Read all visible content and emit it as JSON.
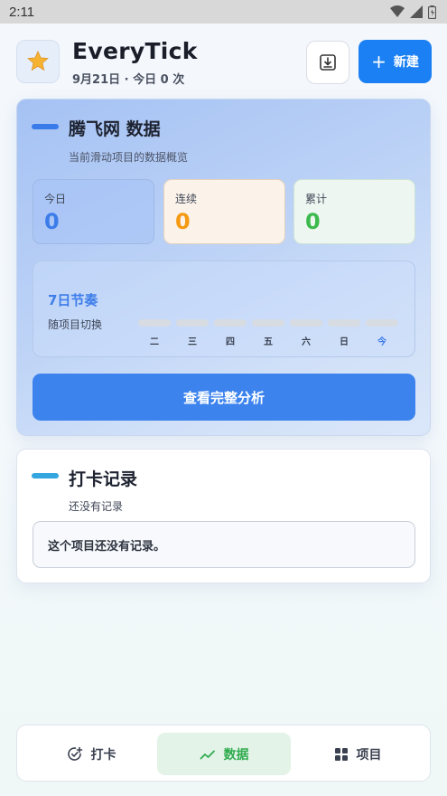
{
  "status_bar": {
    "time": "2:11"
  },
  "header": {
    "app_title": "EveryTick",
    "subtitle": "9月21日 · 今日 0 次",
    "app_icon": "star-icon",
    "import_icon": "download-tray-icon",
    "new_label": "新建"
  },
  "data_card": {
    "title": "腾飞网 数据",
    "subtitle": "当前滑动项目的数据概览",
    "stats": [
      {
        "label": "今日",
        "value": "0",
        "color": "#3d7de9"
      },
      {
        "label": "连续",
        "value": "0",
        "color": "#f59a12"
      },
      {
        "label": "累计",
        "value": "0",
        "color": "#3dba4e"
      }
    ],
    "rhythm": {
      "title": "7日节奏",
      "subtitle": "随项目切换",
      "days": [
        "二",
        "三",
        "四",
        "五",
        "六",
        "日",
        "今"
      ]
    },
    "analysis_button": "查看完整分析"
  },
  "record_card": {
    "title": "打卡记录",
    "subtitle": "还没有记录",
    "empty_message": "这个项目还没有记录。"
  },
  "bottom_nav": {
    "items": [
      {
        "label": "打卡",
        "icon": "check-circle-plus-icon"
      },
      {
        "label": "数据",
        "icon": "trend-line-icon",
        "active": true
      },
      {
        "label": "项目",
        "icon": "grid-icon"
      }
    ]
  },
  "colors": {
    "accent": "#1a80f3",
    "active_tab_bg": "#e3f3e8",
    "active_tab_text": "#2fab4e"
  }
}
